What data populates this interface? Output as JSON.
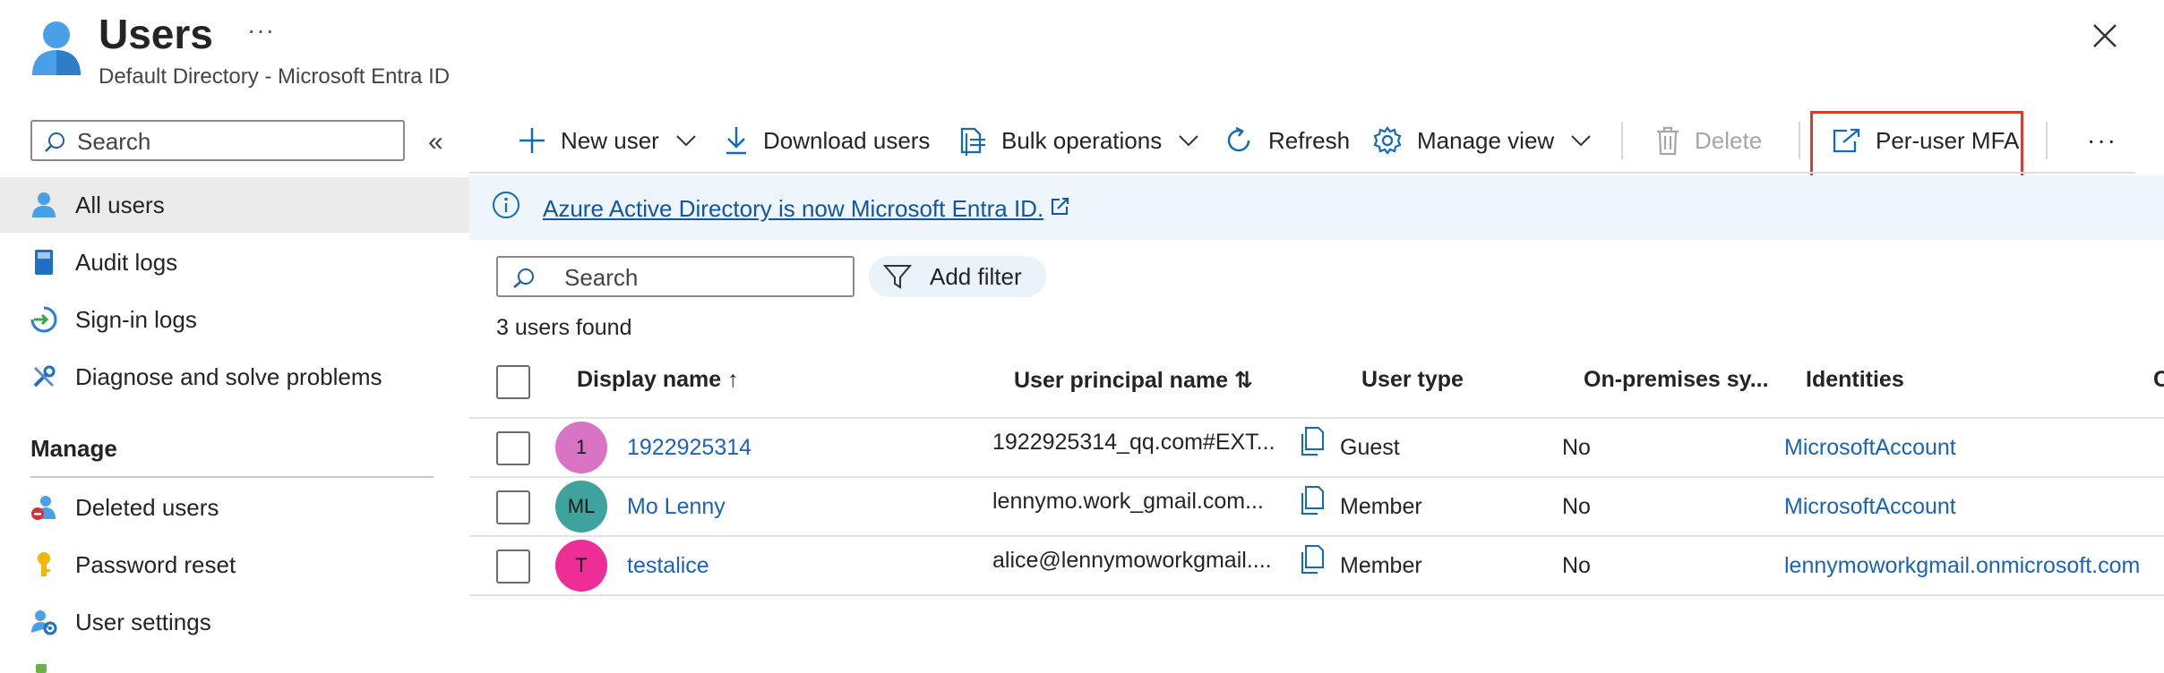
{
  "header": {
    "title": "Users",
    "subtitle": "Default Directory - Microsoft Entra ID",
    "more_glyph": "···",
    "icon": "user-icon",
    "close_icon": "close-icon"
  },
  "sidebar": {
    "search_placeholder": "Search",
    "collapse_glyph": "«",
    "items": [
      {
        "label": "All users",
        "icon": "user-icon",
        "active": true
      },
      {
        "label": "Audit logs",
        "icon": "book-icon"
      },
      {
        "label": "Sign-in logs",
        "icon": "sign-in-icon"
      },
      {
        "label": "Diagnose and solve problems",
        "icon": "wrench-icon"
      }
    ],
    "manage_heading": "Manage",
    "manage_items": [
      {
        "label": "Deleted users",
        "icon": "deleted-user-icon"
      },
      {
        "label": "Password reset",
        "icon": "key-icon"
      },
      {
        "label": "User settings",
        "icon": "user-settings-icon"
      }
    ]
  },
  "toolbar": {
    "new_user": "New user",
    "download_users": "Download users",
    "bulk_operations": "Bulk operations",
    "refresh": "Refresh",
    "manage_view": "Manage view",
    "delete": "Delete",
    "per_user_mfa": "Per-user MFA",
    "more_glyph": "···",
    "accent_color": "#0f6cbd",
    "highlight_color": "#d83b2b"
  },
  "banner": {
    "text": "Azure Active Directory is now Microsoft Entra ID."
  },
  "filters": {
    "search_placeholder": "Search",
    "add_filter": "Add filter",
    "count_text": "3 users found"
  },
  "table": {
    "columns": {
      "display_name": "Display name ↑",
      "upn": "User principal name ⇅",
      "user_type": "User type",
      "onprem": "On-premises sy...",
      "identities": "Identities",
      "cut_off": "C"
    },
    "rows": [
      {
        "initials": "1",
        "avatar_color": "#d974c4",
        "name": "1922925314",
        "upn": "1922925314_qq.com#EXT...",
        "user_type": "Guest",
        "onprem": "No",
        "identities": "MicrosoftAccount"
      },
      {
        "initials": "ML",
        "avatar_color": "#3ea39c",
        "name": "Mo Lenny",
        "upn": "lennymo.work_gmail.com...",
        "user_type": "Member",
        "onprem": "No",
        "identities": "MicrosoftAccount"
      },
      {
        "initials": "T",
        "avatar_color": "#ee2e96",
        "name": "testalice",
        "upn": "alice@lennymoworkgmail....",
        "user_type": "Member",
        "onprem": "No",
        "identities": "lennymoworkgmail.onmicrosoft.com"
      }
    ]
  }
}
